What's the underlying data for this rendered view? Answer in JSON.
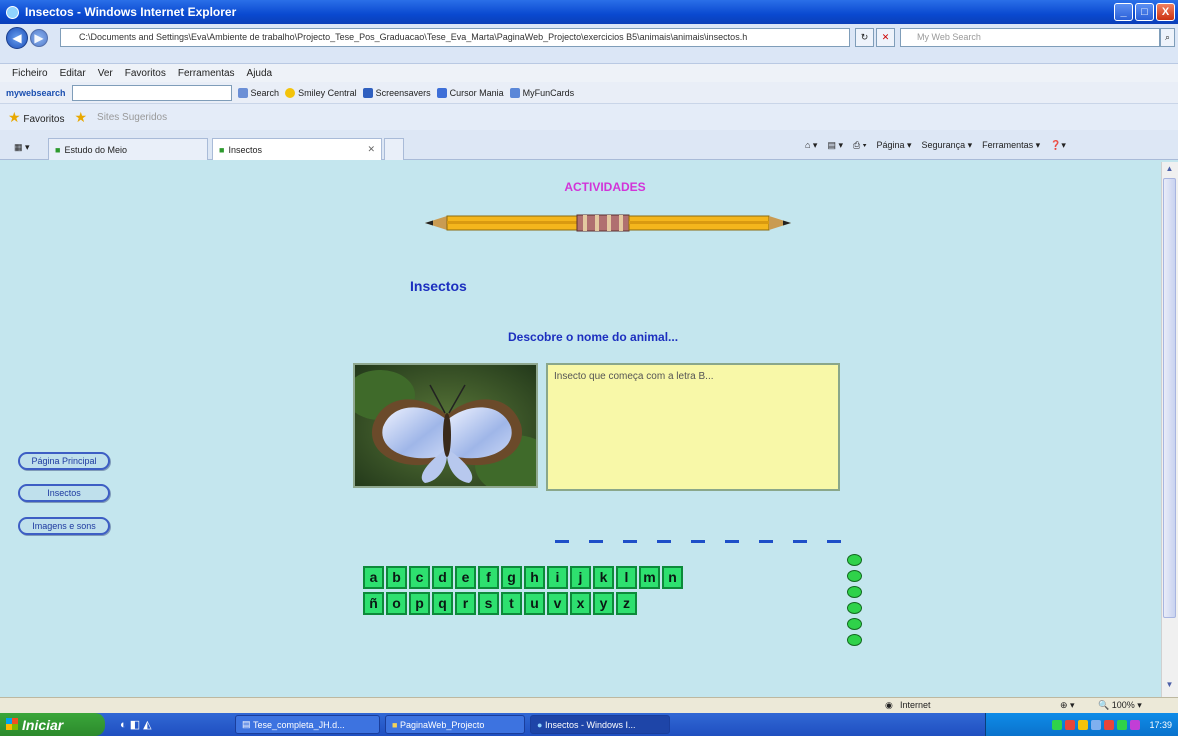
{
  "window": {
    "title": "Insectos - Windows Internet Explorer",
    "minimize_glyph": "_",
    "maximize_glyph": "□",
    "close_glyph": "X"
  },
  "toolbar": {
    "address": "C:\\Documents and Settings\\Eva\\Ambiente de trabalho\\Projecto_Tese_Pos_Graduacao\\Tese_Eva_Marta\\PaginaWeb_Projecto\\exercicios B5\\animais\\animais\\insectos.h",
    "search_placeholder": "My Web Search",
    "menu": [
      "Ficheiro",
      "Editar",
      "Ver",
      "Favoritos",
      "Ferramentas",
      "Ajuda"
    ],
    "mywebsearch_label": "mywebsearch",
    "ws_items": [
      "Search",
      "Smiley Central",
      "Screensavers",
      "Cursor Mania",
      "MyFunCards"
    ],
    "favorites_label": "Favoritos",
    "suggested_sites": "Sites Sugeridos"
  },
  "tabs": [
    {
      "label": "Estudo do Meio"
    },
    {
      "label": "Insectos"
    }
  ],
  "commands": [
    "Página",
    "Segurança",
    "Ferramentas"
  ],
  "page": {
    "heading": "ACTIVIDADES",
    "section_title": "Insectos",
    "instruction": "Descobre o nome do animal...",
    "clue": "Insecto que começa com a letra B..."
  },
  "nav_buttons": [
    "Página Principal",
    "Insectos",
    "Imagens e sons"
  ],
  "answer_slots": 9,
  "keyboard": {
    "row1": [
      "a",
      "b",
      "c",
      "d",
      "e",
      "f",
      "g",
      "h",
      "i",
      "j",
      "k",
      "l",
      "m",
      "n"
    ],
    "row2": [
      "ñ",
      "o",
      "p",
      "q",
      "r",
      "s",
      "t",
      "u",
      "v",
      "x",
      "y",
      "z"
    ]
  },
  "lives_remaining": 6,
  "status": {
    "zone": "Internet",
    "zoom": "100%"
  },
  "taskbar": {
    "start_label": "Iniciar",
    "tasks": [
      "Tese_completa_JH.d...",
      "PaginaWeb_Projecto",
      "Insectos - Windows I..."
    ],
    "clock": "17:39"
  },
  "colors": {
    "page_bg": "#c4e6ee",
    "heading": "#d234d8",
    "title_blue": "#1c2fbf",
    "key_green": "#2ee06f",
    "clue_bg": "#f8f8a8"
  }
}
